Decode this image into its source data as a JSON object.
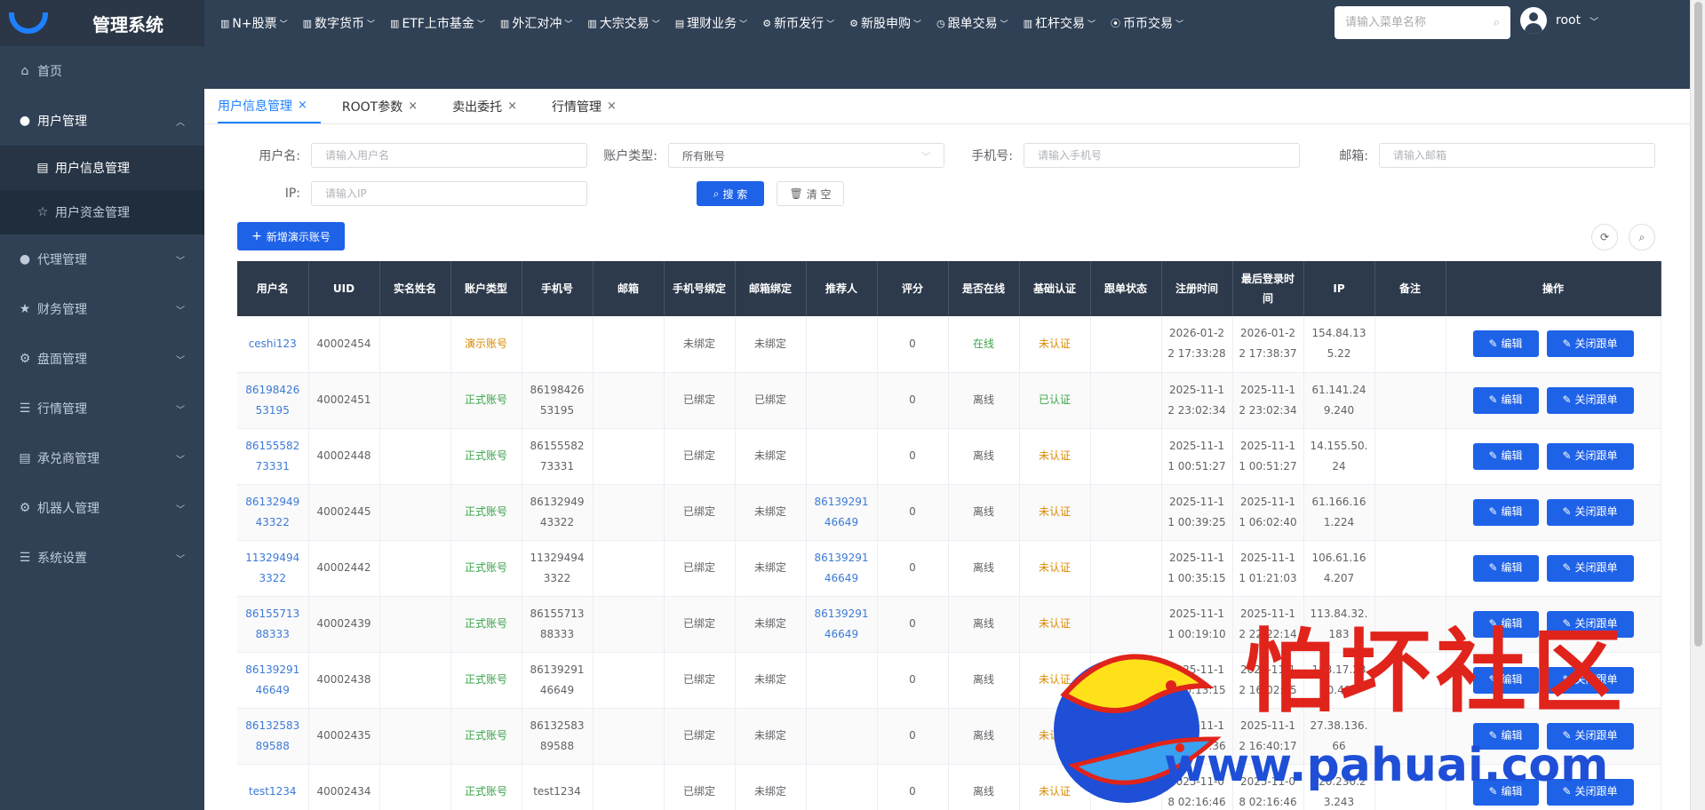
{
  "app": {
    "title": "管理系统"
  },
  "top_nav": [
    {
      "label": "N+股票",
      "icon": "chart-bar-icon"
    },
    {
      "label": "数字货币",
      "icon": "chart-bar-icon"
    },
    {
      "label": "ETF上市基金",
      "icon": "chart-bar-icon"
    },
    {
      "label": "外汇对冲",
      "icon": "chart-bar-icon"
    },
    {
      "label": "大宗交易",
      "icon": "chart-bar-icon"
    },
    {
      "label": "理财业务",
      "icon": "calendar-icon"
    },
    {
      "label": "新币发行",
      "icon": "gear-icon"
    },
    {
      "label": "新股申购",
      "icon": "gear-icon"
    },
    {
      "label": "跟单交易",
      "icon": "clock-icon"
    },
    {
      "label": "杠杆交易",
      "icon": "chart-bar-icon"
    },
    {
      "label": "币币交易",
      "icon": "location-icon"
    }
  ],
  "search": {
    "placeholder": "请输入菜单名称"
  },
  "user": {
    "name": "root"
  },
  "sidebar": {
    "items": [
      {
        "label": "首页",
        "icon": "home-icon"
      },
      {
        "label": "用户管理",
        "icon": "user-icon",
        "expanded": true,
        "children": [
          {
            "label": "用户信息管理",
            "icon": "document-icon",
            "active": true
          },
          {
            "label": "用户资金管理",
            "icon": "star-icon"
          }
        ]
      },
      {
        "label": "代理管理",
        "icon": "user-icon"
      },
      {
        "label": "财务管理",
        "icon": "star-icon"
      },
      {
        "label": "盘面管理",
        "icon": "gear-icon"
      },
      {
        "label": "行情管理",
        "icon": "list-icon"
      },
      {
        "label": "承兑商管理",
        "icon": "document-icon"
      },
      {
        "label": "机器人管理",
        "icon": "gear-icon"
      },
      {
        "label": "系统设置",
        "icon": "list-icon"
      }
    ]
  },
  "tabs": [
    {
      "label": "用户信息管理",
      "active": true
    },
    {
      "label": "ROOT参数"
    },
    {
      "label": "卖出委托"
    },
    {
      "label": "行情管理"
    }
  ],
  "filters": {
    "username": {
      "label": "用户名:",
      "placeholder": "请输入用户名"
    },
    "account_type": {
      "label": "账户类型:",
      "value": "所有账号"
    },
    "phone": {
      "label": "手机号:",
      "placeholder": "请输入手机号"
    },
    "email": {
      "label": "邮箱:",
      "placeholder": "请输入邮箱"
    },
    "ip": {
      "label": "IP:",
      "placeholder": "请输入IP"
    },
    "search_button": "搜 索",
    "clear_button": "清 空"
  },
  "add_button": "新增演示账号",
  "table": {
    "headers": [
      "用户名",
      "UID",
      "实名姓名",
      "账户类型",
      "手机号",
      "邮箱",
      "手机号绑定",
      "邮箱绑定",
      "推荐人",
      "评分",
      "是否在线",
      "基础认证",
      "跟单状态",
      "注册时间",
      "最后登录时间",
      "IP",
      "备注",
      "操作"
    ],
    "rows": [
      {
        "username": "ceshi123",
        "uid": "40002454",
        "real_name": "",
        "account_type": "演示账号",
        "account_demo": true,
        "phone": "",
        "email": "",
        "phone_bind": "未绑定",
        "email_bind": "未绑定",
        "referrer": "",
        "score": "0",
        "online": "在线",
        "is_online": true,
        "auth": "未认证",
        "auth_ok": false,
        "follow": "",
        "register_time": "2026-01-22 17:33:28",
        "last_login": "2026-01-22 17:38:37",
        "ip": "154.84.135.22",
        "remark": ""
      },
      {
        "username": "8619842653195",
        "uid": "40002451",
        "real_name": "",
        "account_type": "正式账号",
        "account_demo": false,
        "phone": "8619842653195",
        "email": "",
        "phone_bind": "已绑定",
        "email_bind": "已绑定",
        "referrer": "",
        "score": "0",
        "online": "离线",
        "is_online": false,
        "auth": "已认证",
        "auth_ok": true,
        "follow": "",
        "register_time": "2025-11-12 23:02:34",
        "last_login": "2025-11-12 23:02:34",
        "ip": "61.141.249.240",
        "remark": ""
      },
      {
        "username": "8615558273331",
        "uid": "40002448",
        "real_name": "",
        "account_type": "正式账号",
        "account_demo": false,
        "phone": "8615558273331",
        "email": "",
        "phone_bind": "已绑定",
        "email_bind": "未绑定",
        "referrer": "",
        "score": "0",
        "online": "离线",
        "is_online": false,
        "auth": "未认证",
        "auth_ok": false,
        "follow": "",
        "register_time": "2025-11-11 00:51:27",
        "last_login": "2025-11-11 00:51:27",
        "ip": "14.155.50.24",
        "remark": ""
      },
      {
        "username": "8613294943322",
        "uid": "40002445",
        "real_name": "",
        "account_type": "正式账号",
        "account_demo": false,
        "phone": "8613294943322",
        "email": "",
        "phone_bind": "已绑定",
        "email_bind": "未绑定",
        "referrer": "8613929146649",
        "score": "0",
        "online": "离线",
        "is_online": false,
        "auth": "未认证",
        "auth_ok": false,
        "follow": "",
        "register_time": "2025-11-11 00:39:25",
        "last_login": "2025-11-11 06:02:40",
        "ip": "61.166.161.224",
        "remark": ""
      },
      {
        "username": "113294943322",
        "uid": "40002442",
        "real_name": "",
        "account_type": "正式账号",
        "account_demo": false,
        "phone": "113294943322",
        "email": "",
        "phone_bind": "已绑定",
        "email_bind": "未绑定",
        "referrer": "8613929146649",
        "score": "0",
        "online": "离线",
        "is_online": false,
        "auth": "未认证",
        "auth_ok": false,
        "follow": "",
        "register_time": "2025-11-11 00:35:15",
        "last_login": "2025-11-11 01:21:03",
        "ip": "106.61.164.207",
        "remark": ""
      },
      {
        "username": "8615571388333",
        "uid": "40002439",
        "real_name": "",
        "account_type": "正式账号",
        "account_demo": false,
        "phone": "8615571388333",
        "email": "",
        "phone_bind": "已绑定",
        "email_bind": "未绑定",
        "referrer": "8613929146649",
        "score": "0",
        "online": "离线",
        "is_online": false,
        "auth": "未认证",
        "auth_ok": false,
        "follow": "",
        "register_time": "2025-11-11 00:19:10",
        "last_login": "2025-11-12 22:22:14",
        "ip": "113.84.32.183",
        "remark": ""
      },
      {
        "username": "8613929146649",
        "uid": "40002438",
        "real_name": "",
        "account_type": "正式账号",
        "account_demo": false,
        "phone": "8613929146649",
        "email": "",
        "phone_bind": "已绑定",
        "email_bind": "未绑定",
        "referrer": "",
        "score": "0",
        "online": "离线",
        "is_online": false,
        "auth": "未认证",
        "auth_ok": false,
        "follow": "",
        "register_time": "2025-11-11 00:13:15",
        "last_login": "2025-11-12 16:02:45",
        "ip": "183.17.230.40",
        "remark": ""
      },
      {
        "username": "8613258389588",
        "uid": "40002435",
        "real_name": "",
        "account_type": "正式账号",
        "account_demo": false,
        "phone": "8613258389588",
        "email": "",
        "phone_bind": "已绑定",
        "email_bind": "未绑定",
        "referrer": "",
        "score": "0",
        "online": "离线",
        "is_online": false,
        "auth": "未认证",
        "auth_ok": false,
        "follow": "",
        "register_time": "2025-11-10 23:24:36",
        "last_login": "2025-11-12 16:40:17",
        "ip": "27.38.136.66",
        "remark": ""
      },
      {
        "username": "test1234",
        "uid": "40002434",
        "real_name": "",
        "account_type": "正式账号",
        "account_demo": false,
        "phone": "test1234",
        "email": "",
        "phone_bind": "已绑定",
        "email_bind": "未绑定",
        "referrer": "",
        "score": "0",
        "online": "离线",
        "is_online": false,
        "auth": "未认证",
        "auth_ok": false,
        "follow": "",
        "register_time": "2025-11-08 02:16:46",
        "last_login": "2025-11-08 02:16:46",
        "ip": "120.230.23.243",
        "remark": ""
      }
    ],
    "edit_label": "编辑",
    "close_label": "关闭跟单"
  },
  "watermark": {
    "title": "怕坏社区",
    "url": "www.pahuai.com"
  },
  "colors": {
    "sidebar": "#304156",
    "primary": "#1e62e8",
    "link": "#3d7ad6",
    "warning": "#d98a00",
    "success": "#3aa548"
  }
}
